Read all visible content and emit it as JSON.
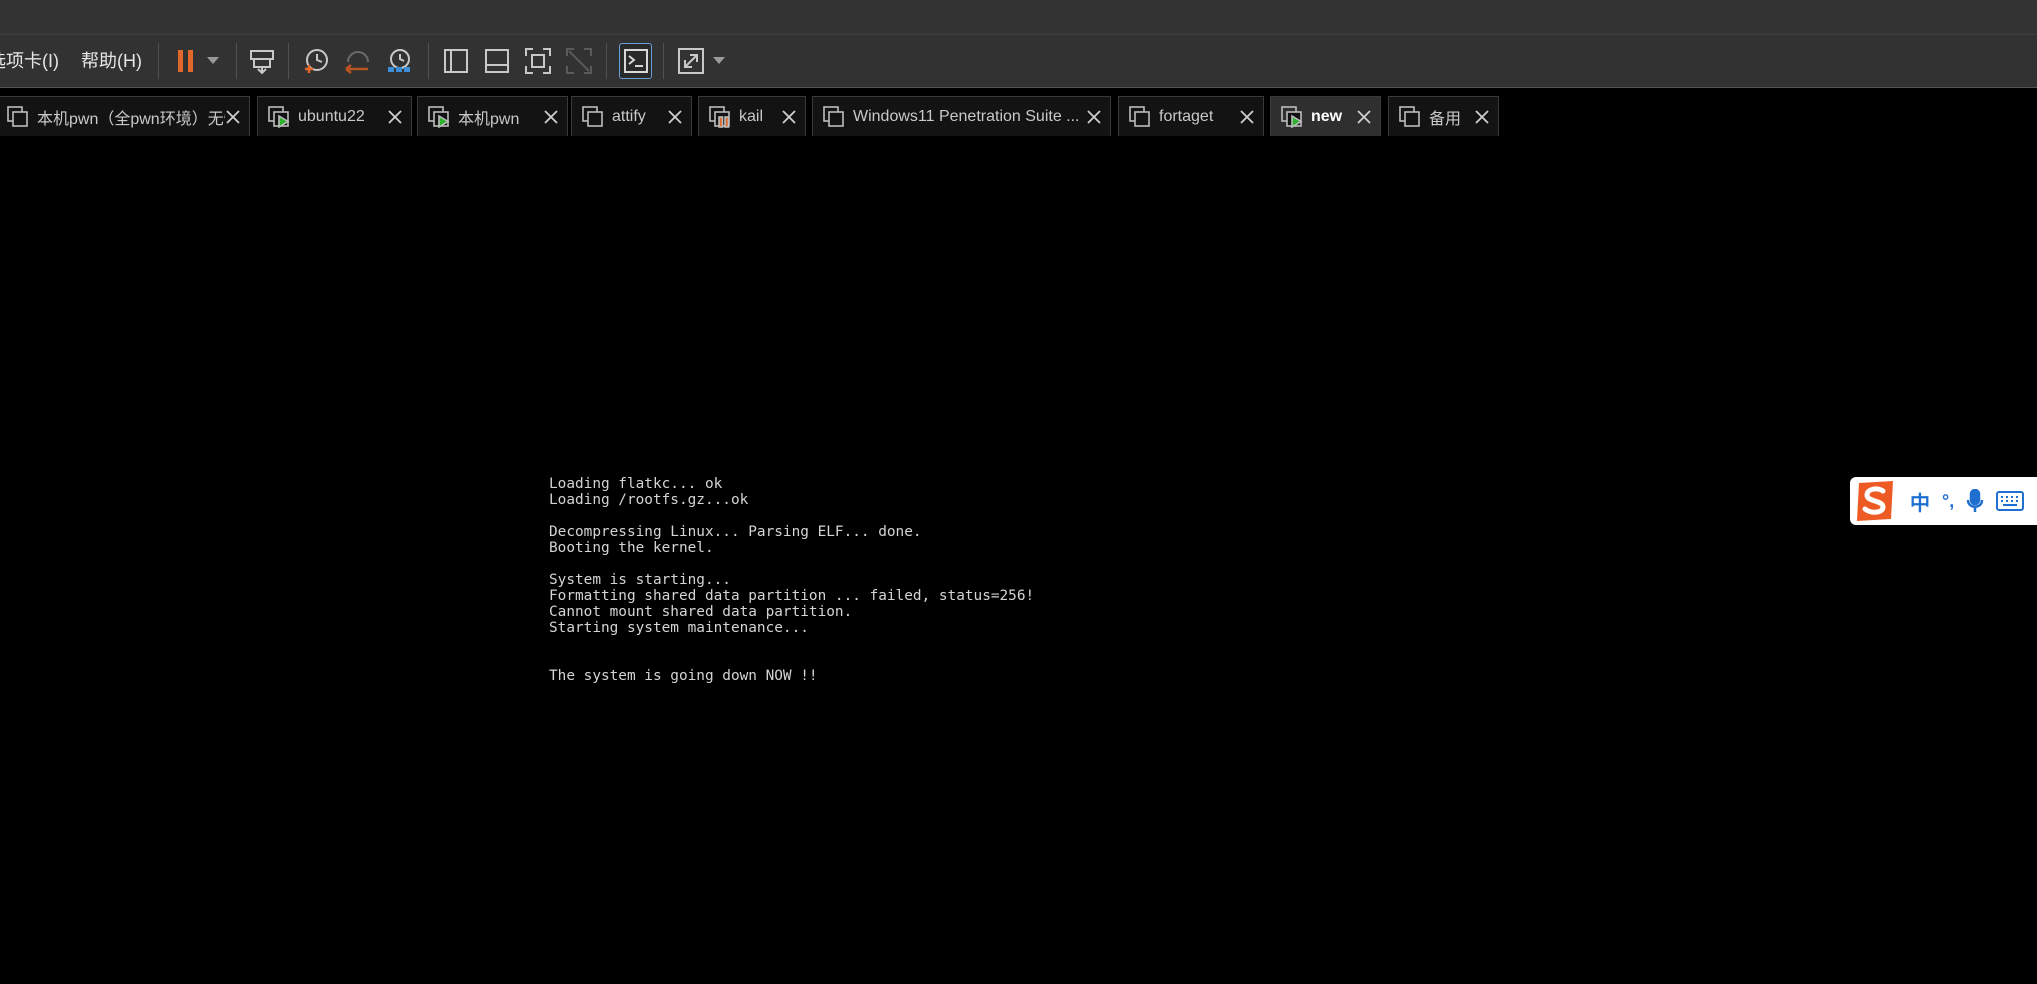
{
  "menu": {
    "tabs_label": "选项卡(I)",
    "help_label": "帮助(H)"
  },
  "toolbar": {
    "icons": [
      "pause-icon",
      "dropdown-arrow-icon",
      "send-ctrl-alt-del-icon",
      "snapshot-icon",
      "revert-snapshot-icon",
      "snapshot-manager-icon",
      "show-library-icon",
      "thumbnail-bar-icon",
      "full-screen-icon",
      "unity-icon",
      "console-view-icon",
      "stretch-guest-icon",
      "stretch-dropdown-icon"
    ],
    "accent_pause": "#e2672a",
    "accent_active_border": "#6a9fd8"
  },
  "tabs": [
    {
      "label": "本机pwn（全pwn环境）无忧...",
      "status": "stopped"
    },
    {
      "label": "ubuntu22",
      "status": "running"
    },
    {
      "label": "本机pwn",
      "status": "running"
    },
    {
      "label": "attify",
      "status": "stopped"
    },
    {
      "label": "kail",
      "status": "paused"
    },
    {
      "label": "Windows11 Penetration Suite ...",
      "status": "stopped"
    },
    {
      "label": "fortaget",
      "status": "stopped"
    },
    {
      "label": "new",
      "status": "running",
      "active": true
    },
    {
      "label": "备用",
      "status": "stopped"
    }
  ],
  "console": {
    "lines": [
      "Loading flatkc... ok",
      "Loading /rootfs.gz...ok",
      "",
      "Decompressing Linux... Parsing ELF... done.",
      "Booting the kernel.",
      "",
      "System is starting...",
      "Formatting shared data partition ... failed, status=256!",
      "Cannot mount shared data partition.",
      "Starting system maintenance...",
      "",
      "",
      "The system is going down NOW !!"
    ],
    "text_color": "#d4d4d4",
    "background": "#000000"
  },
  "ime_toolbar": {
    "logo": "sogou-logo-icon",
    "mode_label": "中",
    "punct_label": "°,",
    "brand_color": "#ee5a24",
    "icon_color": "#1f6fd1"
  }
}
